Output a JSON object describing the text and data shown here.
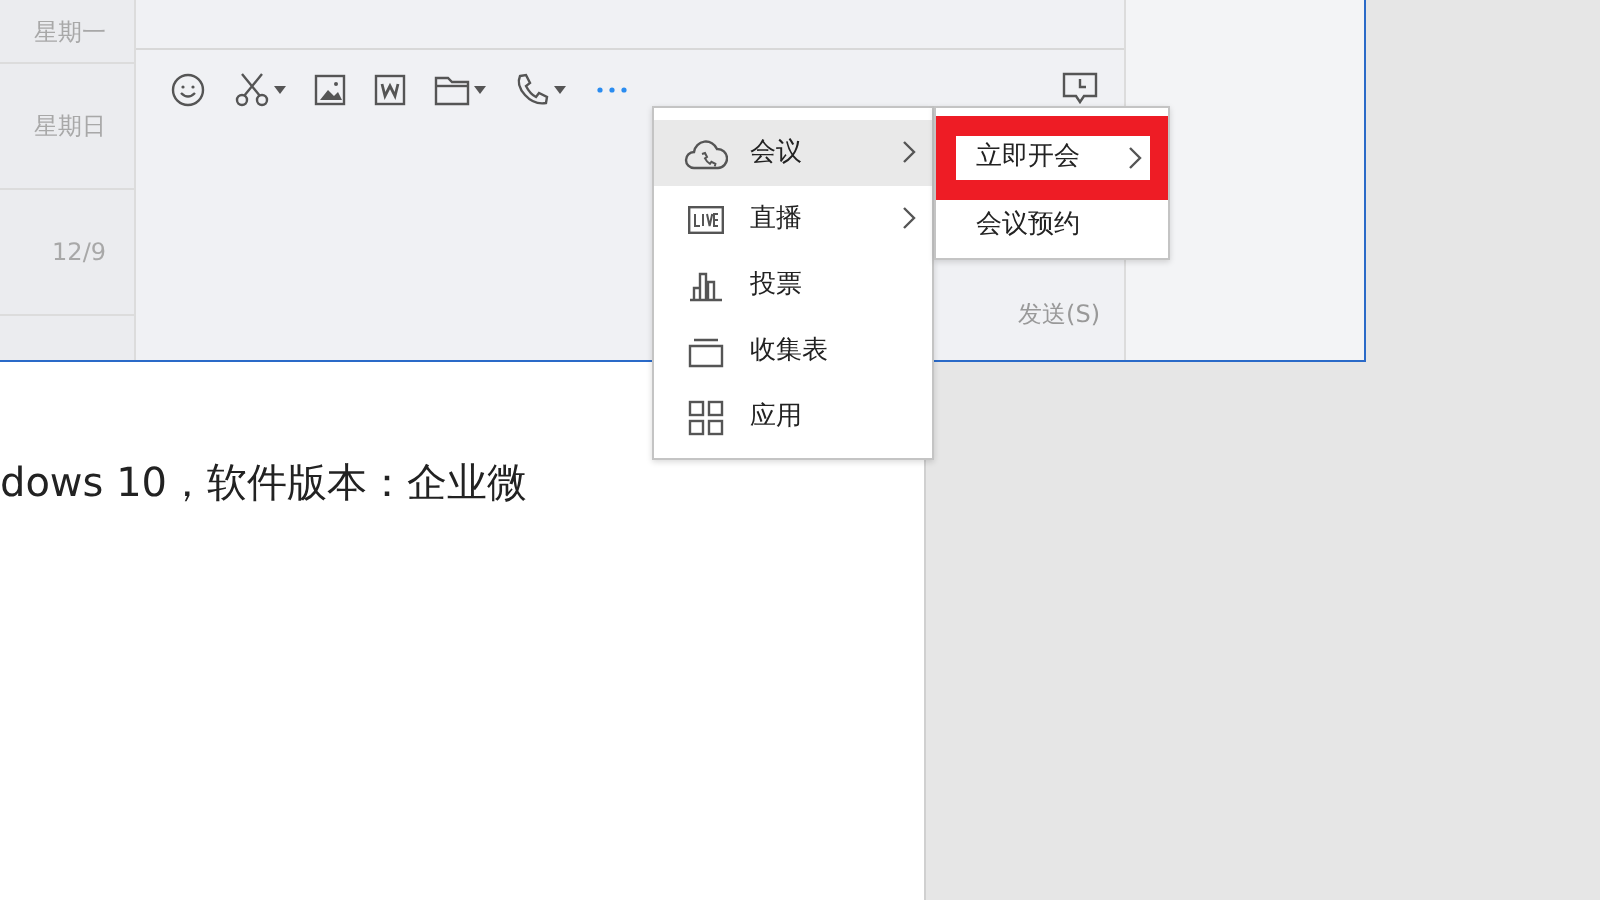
{
  "chat_window": {
    "date_list": [
      {
        "label": "星期一"
      },
      {
        "label": "星期日"
      },
      {
        "label": "12/9"
      }
    ],
    "toolbar": [
      {
        "kind": "emoji",
        "caret": false
      },
      {
        "kind": "scissors",
        "caret": true
      },
      {
        "kind": "image",
        "caret": false
      },
      {
        "kind": "word",
        "caret": false
      },
      {
        "kind": "folder",
        "caret": true
      },
      {
        "kind": "phone",
        "caret": true
      },
      {
        "kind": "more",
        "caret": false
      }
    ],
    "send_button": "发送(S)"
  },
  "menu": {
    "items": [
      {
        "kind": "cloud",
        "label": "会议",
        "submenu": true,
        "selected": true
      },
      {
        "kind": "live",
        "label": "直播",
        "submenu": true,
        "selected": false
      },
      {
        "kind": "bars",
        "label": "投票",
        "submenu": false,
        "selected": false
      },
      {
        "kind": "tray",
        "label": "收集表",
        "submenu": false,
        "selected": false
      },
      {
        "kind": "grid",
        "label": "应用",
        "submenu": false,
        "selected": false
      }
    ]
  },
  "submenu": {
    "items": [
      {
        "label": "立即开会",
        "submenu": true,
        "annotated": true
      },
      {
        "label": "会议预约",
        "submenu": false,
        "annotated": false
      }
    ]
  },
  "document": {
    "line": "dows 10，软件版本：企业微"
  }
}
